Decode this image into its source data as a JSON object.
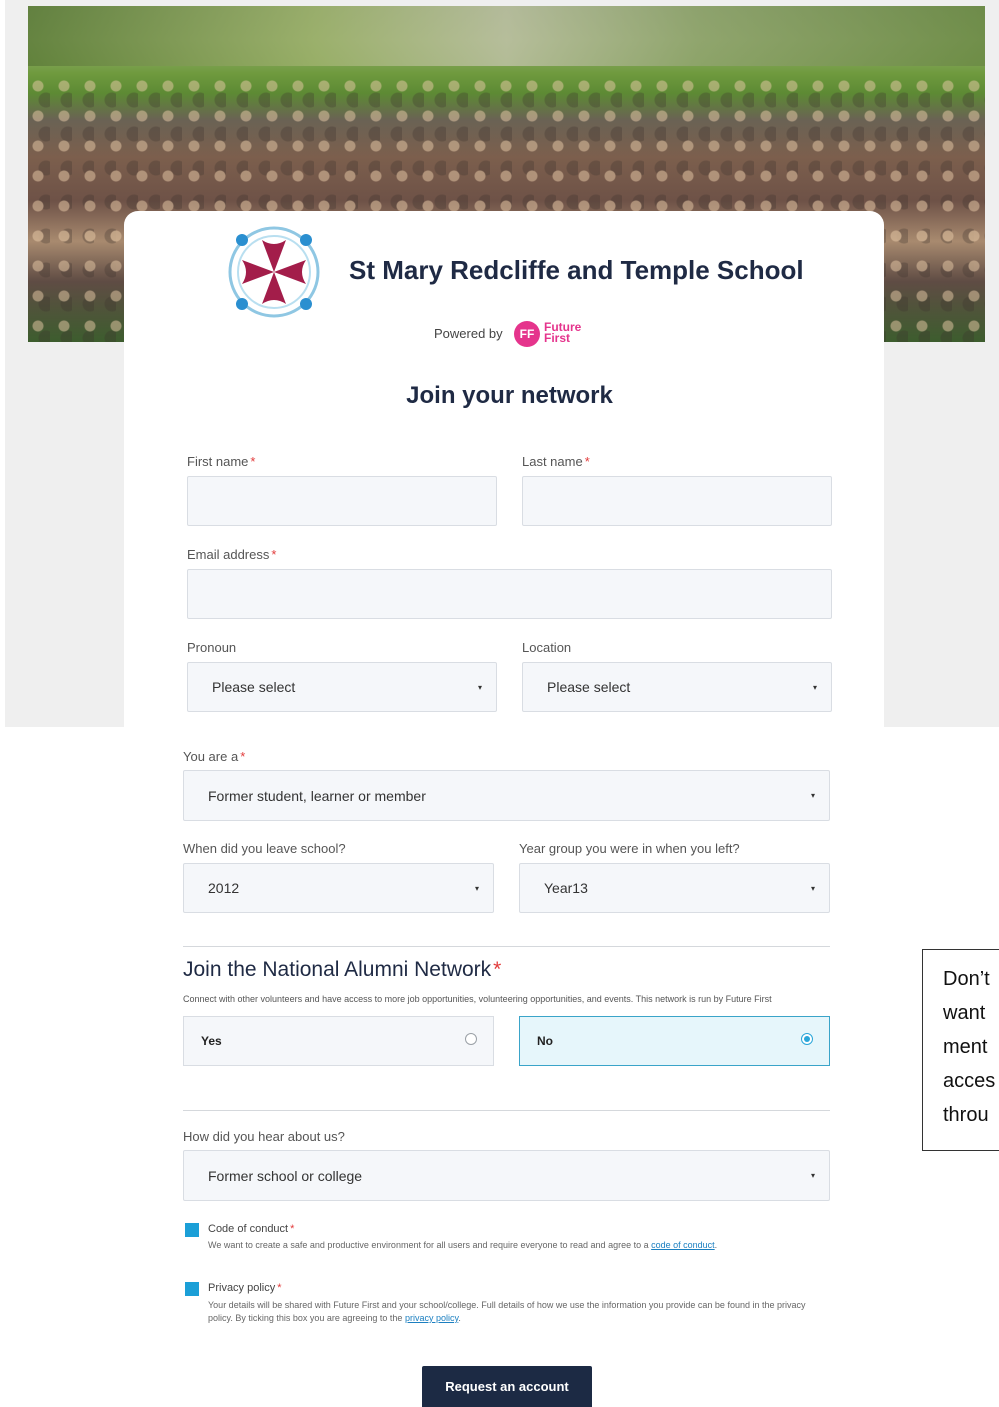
{
  "header": {
    "school_name": "St Mary Redcliffe and Temple School",
    "powered_by": "Powered by",
    "brand_badge": "FF",
    "brand_line1": "Future",
    "brand_line2": "First",
    "brand_color": "#e5348c"
  },
  "form": {
    "title": "Join your network",
    "first_name": {
      "label": "First name",
      "value": ""
    },
    "last_name": {
      "label": "Last name",
      "value": ""
    },
    "email": {
      "label": "Email address",
      "value": ""
    },
    "pronoun": {
      "label": "Pronoun",
      "selected": "Please select"
    },
    "location": {
      "label": "Location",
      "selected": "Please select"
    },
    "you_are": {
      "label": "You are a",
      "selected": "Former student, learner or member"
    },
    "leave_year": {
      "label": "When did you leave school?",
      "selected": "2012"
    },
    "year_group": {
      "label": "Year group you were in when you left?",
      "selected": "Year13"
    },
    "alumni": {
      "heading": "Join the National Alumni Network",
      "description": "Connect with other volunteers and have access to more job opportunities, volunteering opportunities, and events. This network is run by Future First",
      "options": [
        "Yes",
        "No"
      ],
      "selected": "No"
    },
    "hear_about": {
      "label": "How did you hear about us?",
      "selected": "Former school or college"
    },
    "code_of_conduct": {
      "title": "Code of conduct",
      "desc": "We want to create a safe and productive environment for all users and require everyone to read and agree to a",
      "link": "code of conduct",
      "checked": true
    },
    "privacy": {
      "title": "Privacy policy",
      "desc": "Your details will be shared with Future First and your school/college. Full details of how we use the information you provide can be found in the privacy policy. By ticking this box you are agreeing to the",
      "link": "privacy policy",
      "checked": true
    },
    "submit_label": "Request an account",
    "required_mark": "*"
  },
  "note": {
    "lines": [
      "Don’t",
      "want",
      "ment",
      "acces",
      "throu"
    ]
  },
  "colors": {
    "navy": "#1c2a44",
    "accent": "#1b9fd7",
    "required": "#e23b3b"
  },
  "icons": {
    "select_caret": "▾"
  }
}
